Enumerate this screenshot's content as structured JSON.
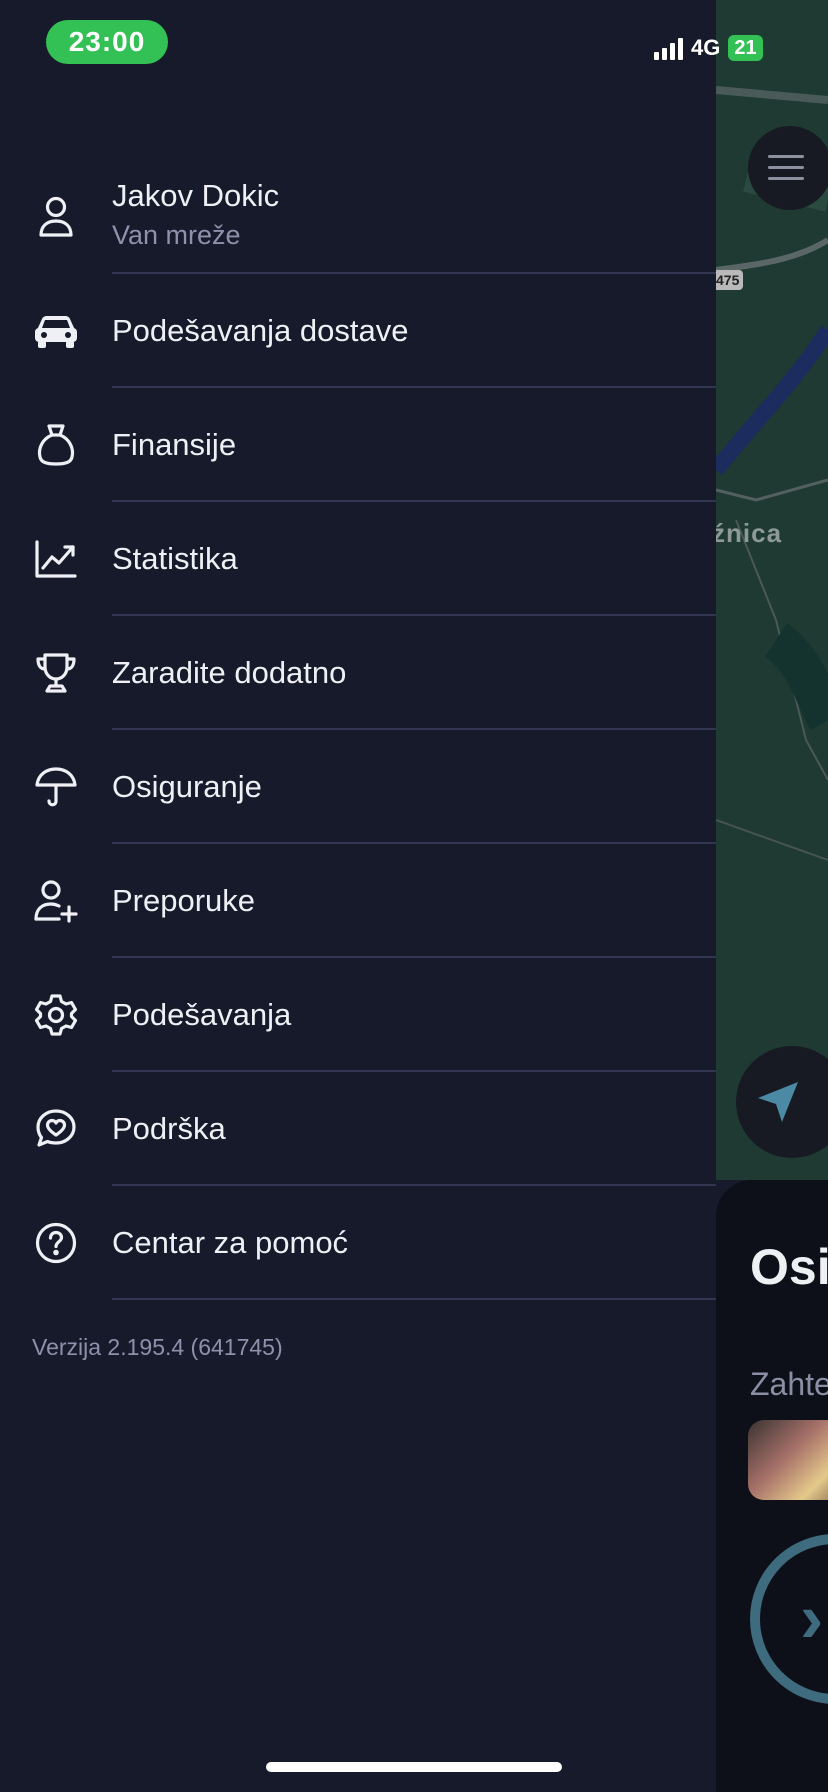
{
  "status_bar": {
    "time": "23:00",
    "network": "4G",
    "battery": "21"
  },
  "profile": {
    "name": "Jakov Dokic",
    "status": "Van mreže"
  },
  "menu": {
    "items": [
      {
        "label": "Podešavanja dostave",
        "icon": "car-icon"
      },
      {
        "label": "Finansije",
        "icon": "money-bag-icon"
      },
      {
        "label": "Statistika",
        "icon": "chart-icon"
      },
      {
        "label": "Zaradite dodatno",
        "icon": "trophy-icon"
      },
      {
        "label": "Osiguranje",
        "icon": "umbrella-icon"
      },
      {
        "label": "Preporuke",
        "icon": "add-user-icon"
      },
      {
        "label": "Podešavanja",
        "icon": "gear-icon"
      },
      {
        "label": "Podrška",
        "icon": "chat-heart-icon"
      },
      {
        "label": "Centar za pomoć",
        "icon": "help-icon"
      }
    ]
  },
  "version": "Verzija 2.195.4 (641745)",
  "background": {
    "map_road_number": "475",
    "map_place_label": "źnica",
    "sheet_title": "Osi",
    "sheet_subtitle": "Zahte"
  },
  "colors": {
    "drawer_bg": "#171a2a",
    "text": "#eef0f5",
    "muted": "#8c91ac",
    "divider": "#323650",
    "status_green": "#33c156"
  }
}
